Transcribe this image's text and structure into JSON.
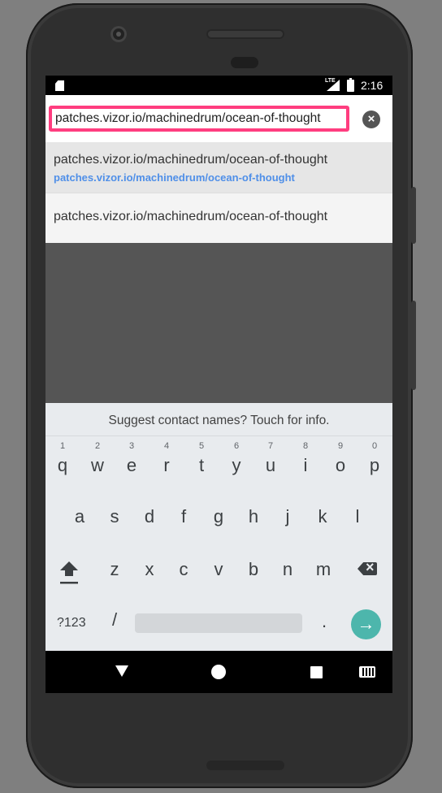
{
  "status_bar": {
    "network": "LTE",
    "time": "2:16"
  },
  "url_bar": {
    "value": "patches.vizor.io/machinedrum/ocean-of-thought"
  },
  "suggestions": [
    {
      "title": "patches.vizor.io/machinedrum/ocean-of-thought",
      "url": "patches.vizor.io/machinedrum/ocean-of-thought"
    },
    {
      "title": "patches.vizor.io/machinedrum/ocean-of-thought"
    }
  ],
  "keyboard": {
    "hint": "Suggest contact names? Touch for info.",
    "row1": [
      "q",
      "w",
      "e",
      "r",
      "t",
      "y",
      "u",
      "i",
      "o",
      "p"
    ],
    "row1_hints": [
      "1",
      "2",
      "3",
      "4",
      "5",
      "6",
      "7",
      "8",
      "9",
      "0"
    ],
    "row2": [
      "a",
      "s",
      "d",
      "f",
      "g",
      "h",
      "j",
      "k",
      "l"
    ],
    "row3": [
      "z",
      "x",
      "c",
      "v",
      "b",
      "n",
      "m"
    ],
    "symbols_key": "?123",
    "slash_key": "/",
    "period_key": ".",
    "go_key": "→"
  },
  "icons": {
    "clear": "close-circle-icon",
    "shift": "shift-icon",
    "backspace": "backspace-icon",
    "back": "back-icon",
    "home": "home-icon",
    "recents": "recents-icon",
    "keyboard": "keyboard-icon"
  },
  "colors": {
    "highlight_border": "#ff3d7f",
    "suggestion_url": "#4f8fe8",
    "go_button": "#4db6ac"
  }
}
